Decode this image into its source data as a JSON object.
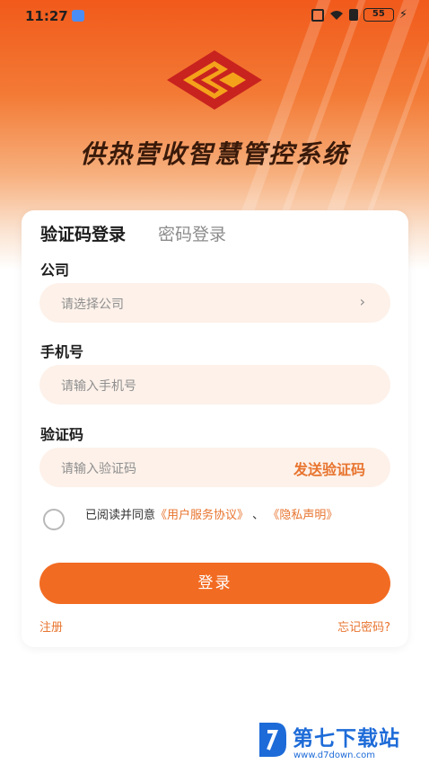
{
  "status": {
    "time": "11:27",
    "battery": "55"
  },
  "app": {
    "title": "供热营收智慧管控系统"
  },
  "tabs": {
    "sms": "验证码登录",
    "password": "密码登录"
  },
  "form": {
    "company_label": "公司",
    "company_placeholder": "请选择公司",
    "phone_label": "手机号",
    "phone_placeholder": "请输入手机号",
    "code_label": "验证码",
    "code_placeholder": "请输入验证码",
    "send_code": "发送验证码"
  },
  "agreement": {
    "prefix": "已阅读并同意",
    "user_agreement": "《用户服务协议》",
    "separator": "、",
    "privacy": "《隐私声明》"
  },
  "actions": {
    "login": "登录",
    "register": "注册",
    "forgot": "忘记密码?"
  },
  "watermark": {
    "name": "第七下载站",
    "url": "www.d7down.com"
  },
  "colors": {
    "accent": "#f26b22",
    "link": "#e8742f",
    "field_bg": "#fdf1e9"
  }
}
